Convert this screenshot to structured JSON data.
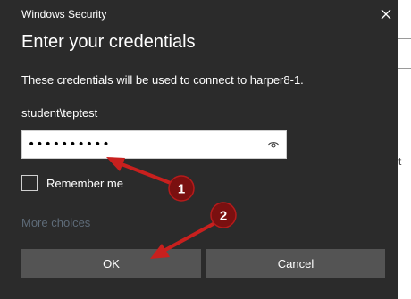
{
  "window": {
    "title": "Windows Security",
    "close_icon": "close-icon"
  },
  "dialog": {
    "heading": "Enter your credentials",
    "description": "These credentials will be used to connect to harper8-1.",
    "username": "student\\teptest",
    "password_value": "••••••••••",
    "password_reveal_icon": "eye-icon",
    "remember_label": "Remember me",
    "remember_checked": false,
    "more_choices": "More choices",
    "ok_label": "OK",
    "cancel_label": "Cancel"
  },
  "annotations": [
    {
      "number": "1",
      "icon": "arrow-icon",
      "color": "#c8201e"
    },
    {
      "number": "2",
      "icon": "arrow-icon",
      "color": "#c8201e"
    }
  ],
  "colors": {
    "dialog_bg": "#2b2b2b",
    "button_bg": "#545454",
    "muted_link": "#5e6b78",
    "annotation_red": "#c8201e",
    "badge_dark": "#7a1010"
  }
}
